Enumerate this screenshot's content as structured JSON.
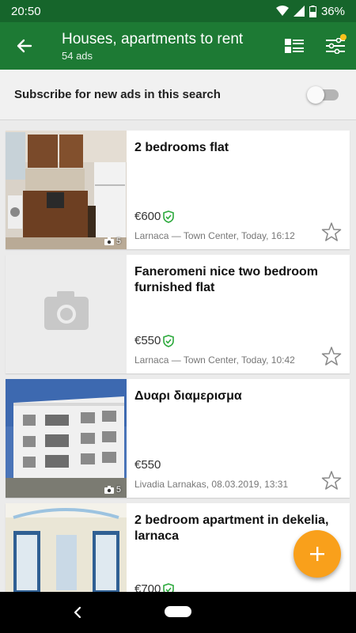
{
  "status_bar": {
    "time": "20:50",
    "battery": "36%"
  },
  "app_bar": {
    "title": "Houses, apartments to rent",
    "subtitle": "54 ads"
  },
  "subscribe": {
    "label": "Subscribe for new ads in this search",
    "enabled": false
  },
  "ads": [
    {
      "title": "2 bedrooms flat",
      "price": "€600",
      "verified": true,
      "meta": "Larnaca — Town Center, Today, 16:12",
      "photos": "5",
      "image": "kitchen"
    },
    {
      "title": "Faneromeni nice two bedroom furnished flat",
      "price": "€550",
      "verified": true,
      "meta": "Larnaca — Town Center, Today, 10:42",
      "photos": "",
      "image": "placeholder"
    },
    {
      "title": "Δυαρι διαμερισμα",
      "price": "€550",
      "verified": false,
      "meta": "Livadia Larnakas, 08.03.2019, 13:31",
      "photos": "5",
      "image": "building"
    },
    {
      "title": "2 bedroom apartment in dekelia, larnaca",
      "price": "€700",
      "verified": true,
      "meta": "",
      "photos": "",
      "image": "interior"
    }
  ],
  "colors": {
    "primary": "#1d7a34",
    "status": "#16652b",
    "accent": "#f9a01b",
    "verified": "#2eaa3e"
  },
  "icons": {
    "back": "arrow-left-icon",
    "view": "list-view-icon",
    "filter": "filter-sliders-icon",
    "fab": "plus-icon",
    "favorite": "star-outline-icon"
  }
}
